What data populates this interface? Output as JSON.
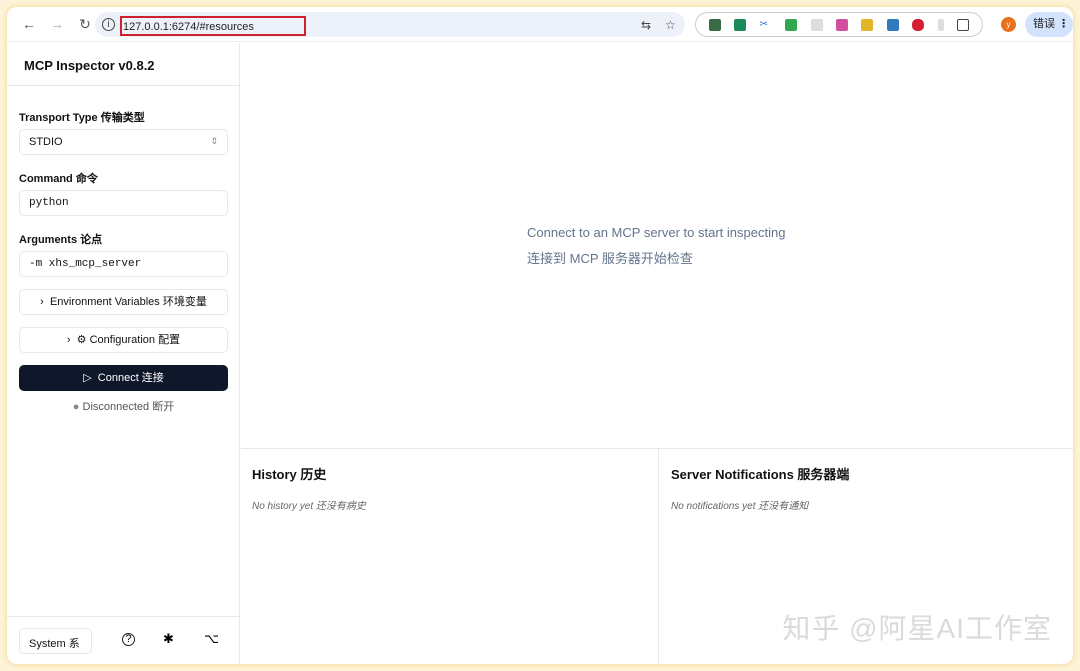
{
  "browser": {
    "url": "127.0.0.1:6274/#resources",
    "profile_initial": "y",
    "error_label": "错误"
  },
  "sidebar": {
    "title": "MCP Inspector v0.8.2",
    "transport_label": "Transport Type 传输类型",
    "transport_value": "STDIO",
    "command_label": "Command 命令",
    "command_value": "python",
    "arguments_label": "Arguments 论点",
    "arguments_value": "-m xhs_mcp_server",
    "env_button": "Environment Variables 环境变量",
    "config_button": "Configuration 配置",
    "connect_button": "Connect 连接",
    "status": "Disconnected 断开",
    "theme_value": "System 系"
  },
  "main": {
    "empty_line1": "Connect to an MCP server to start inspecting",
    "empty_line2": "连接到 MCP 服务器开始检查",
    "history_title": "History 历史",
    "history_empty": "No history yet  还没有病史",
    "notifications_title": "Server Notifications 服务器端",
    "notifications_empty": "No notifications yet  还没有通知"
  },
  "watermark": "知乎 @阿星AI工作室"
}
